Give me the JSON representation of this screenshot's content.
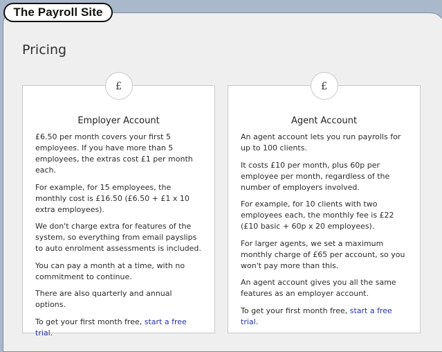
{
  "site": {
    "logo_text": "The Payroll Site"
  },
  "page": {
    "title": "Pricing"
  },
  "cards": [
    {
      "icon": "pound-sign-icon",
      "icon_glyph": "£",
      "title": "Employer Account",
      "paragraphs": [
        "£6.50 per month covers your first 5 employees. If you have more than 5 employees, the extras cost £1 per month each.",
        "For example, for 15 employees, the monthly cost is £16.50 (£6.50 + £1 x 10 extra employees).",
        "We don't charge extra for features of the system, so everything from email payslips to auto enrolment assessments is included.",
        "You can pay a month at a time, with no commitment to continue.",
        "There are also quarterly and annual options."
      ],
      "trial_prefix": "To get your first month free, ",
      "trial_link": "start a free trial",
      "trial_suffix": "."
    },
    {
      "icon": "pound-sign-icon",
      "icon_glyph": "£",
      "title": "Agent Account",
      "paragraphs": [
        "An agent account lets you run payrolls for up to 100 clients.",
        "It costs £10 per month, plus 60p per employee per month, regardless of the number of employers involved.",
        "For example, for 10 clients with two employees each, the monthly fee is £22 (£10 basic + 60p x 20 employees).",
        "For larger agents, we set a maximum monthly charge of £65 per account, so you won't pay more than this.",
        "An agent account gives you all the same features as an employer account."
      ],
      "trial_prefix": "To get your first month free, ",
      "trial_link": "start a free trial",
      "trial_suffix": "."
    }
  ],
  "colors": {
    "background": "#a9b9cb",
    "panel": "#efefef",
    "link": "#2233aa"
  }
}
